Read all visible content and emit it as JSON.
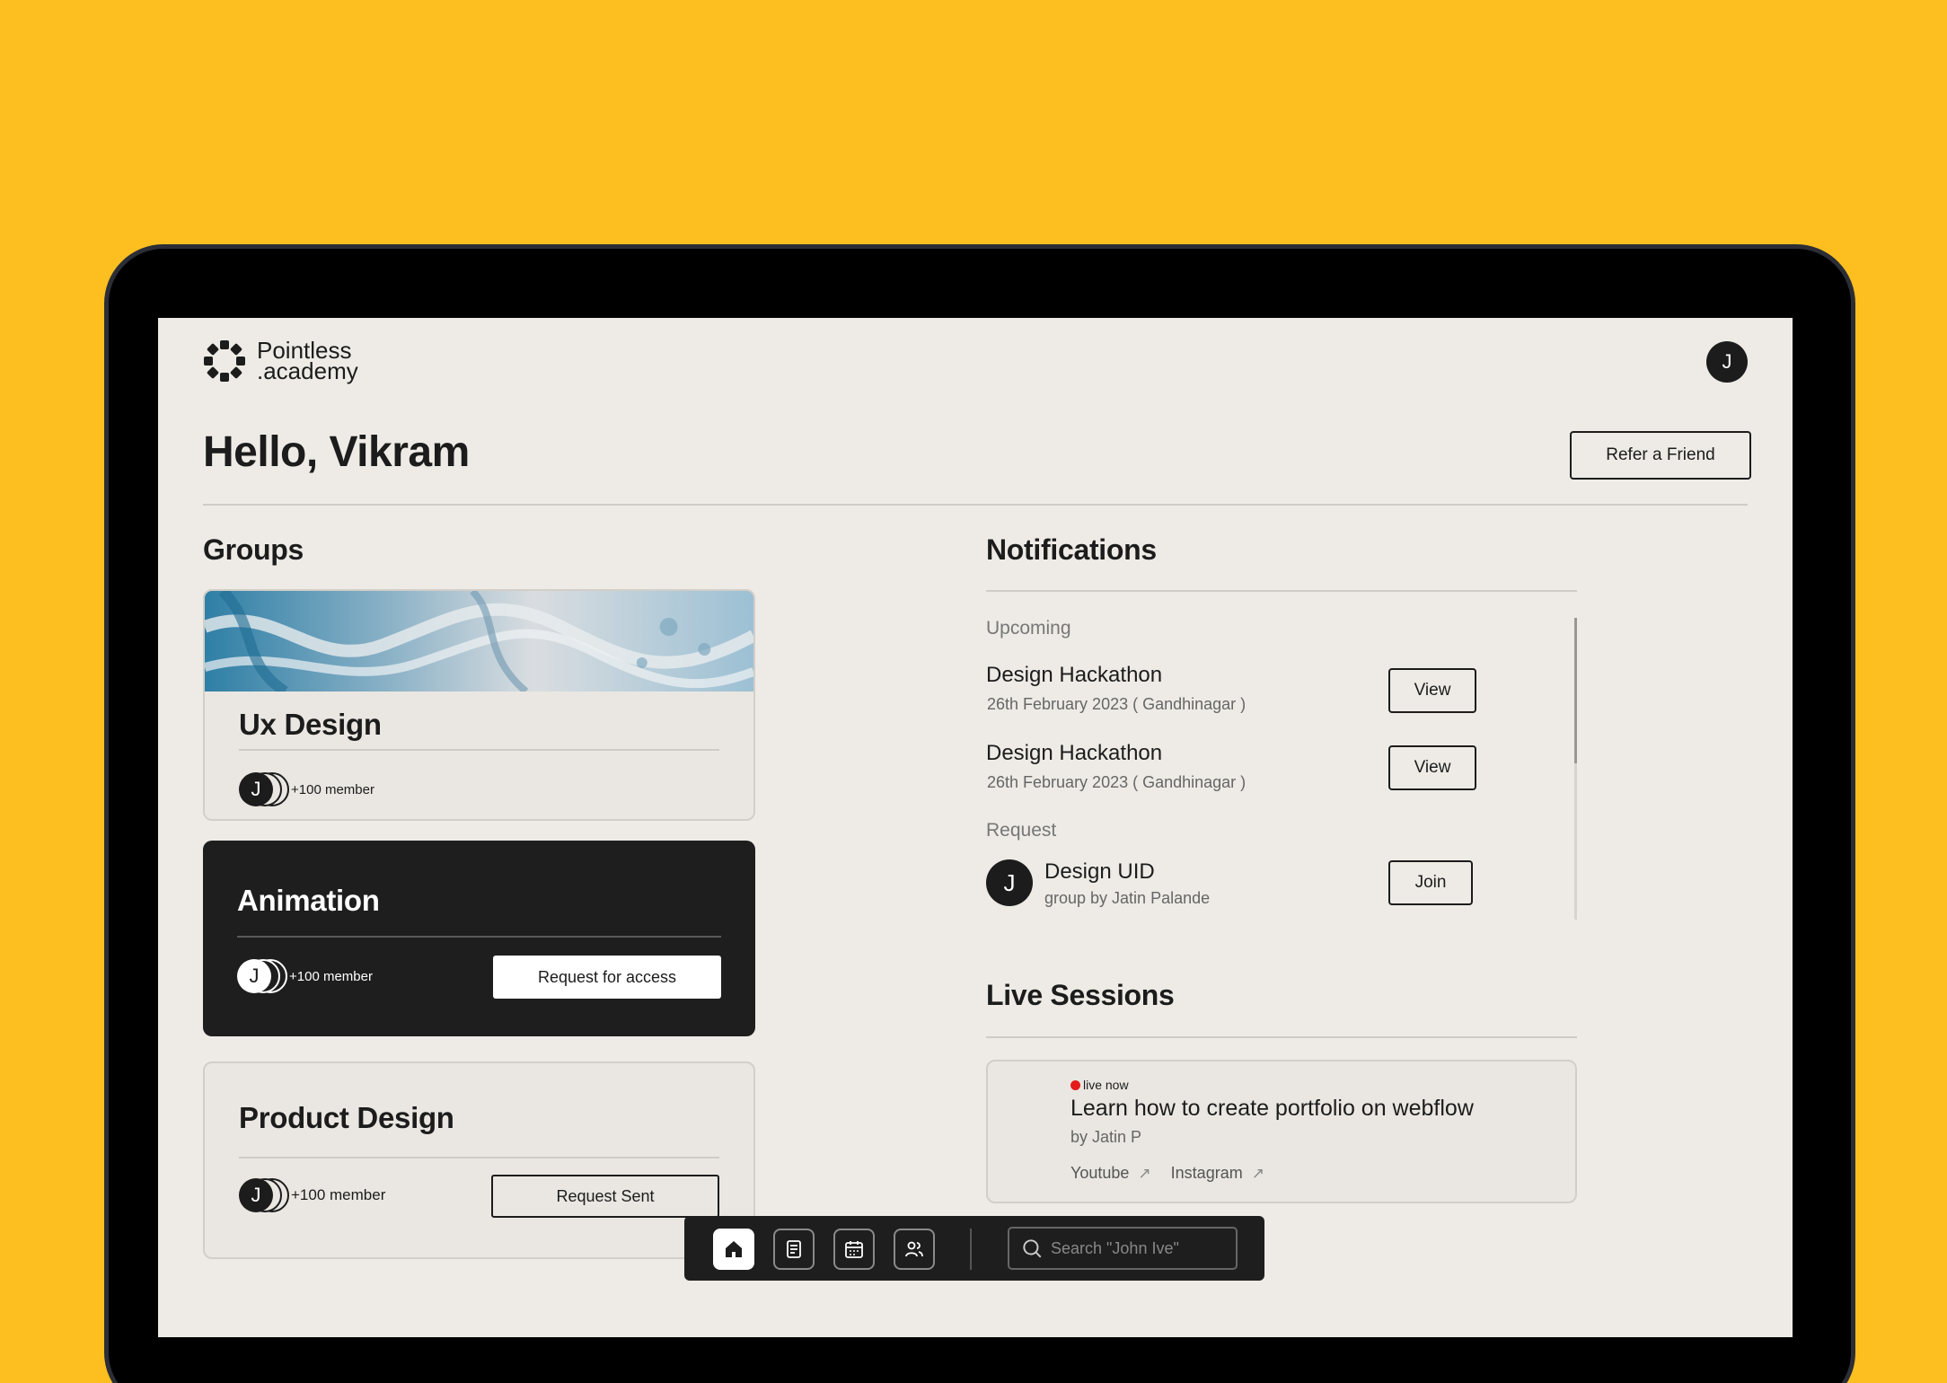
{
  "brand": {
    "line1": "Pointless",
    "line2": ".academy"
  },
  "user": {
    "initial": "J"
  },
  "greeting": "Hello, Vikram",
  "refer_label": "Refer a Friend",
  "groups": {
    "title": "Groups",
    "items": [
      {
        "name": "Ux Design",
        "initial": "J",
        "members": "+100 member"
      },
      {
        "name": "Animation",
        "initial": "J",
        "members": "+100 member",
        "action": "Request for access"
      },
      {
        "name": "Product Design",
        "initial": "J",
        "members": "+100 member",
        "action": "Request Sent"
      }
    ]
  },
  "notifications": {
    "title": "Notifications",
    "upcoming_label": "Upcoming",
    "upcoming": [
      {
        "title": "Design Hackathon",
        "subtitle": "26th February 2023 ( Gandhinagar )",
        "action": "View"
      },
      {
        "title": "Design Hackathon",
        "subtitle": "26th February 2023 ( Gandhinagar )",
        "action": "View"
      }
    ],
    "request_label": "Request",
    "request": {
      "initial": "J",
      "title": "Design UID",
      "subtitle": "group by Jatin Palande",
      "action": "Join"
    }
  },
  "live_sessions": {
    "title": "Live Sessions",
    "item": {
      "badge": "live now",
      "title": "Learn how to create portfolio on webflow",
      "by": "by Jatin P",
      "links": [
        "Youtube",
        "Instagram"
      ]
    }
  },
  "dock": {
    "icons": [
      "home-icon",
      "notes-icon",
      "calendar-icon",
      "users-icon"
    ],
    "search_placeholder": "Search \"John Ive\""
  },
  "colors": {
    "background": "#FDBF1F",
    "screen": "#EEEBE6",
    "dark": "#1E1E1E",
    "live": "#E31B1B"
  }
}
